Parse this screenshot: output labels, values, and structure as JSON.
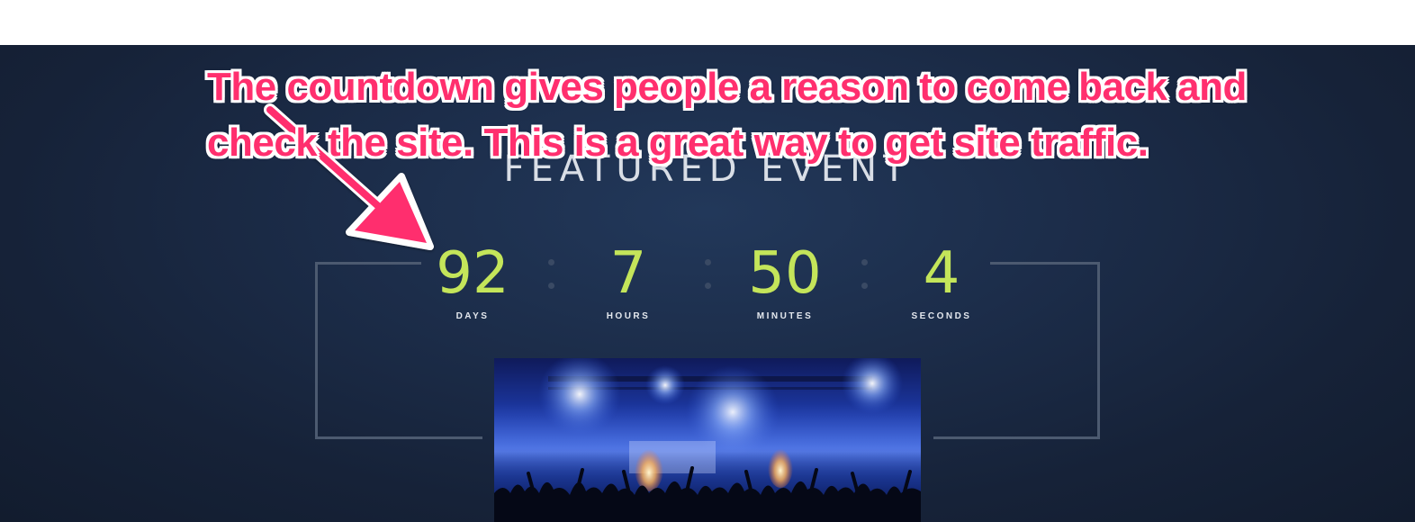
{
  "featured": {
    "title": "FEATURED EVENT"
  },
  "countdown": {
    "units": [
      {
        "value": "92",
        "label": "DAYS"
      },
      {
        "value": "7",
        "label": "HOURS"
      },
      {
        "value": "50",
        "label": "MINUTES"
      },
      {
        "value": "4",
        "label": "SECONDS"
      }
    ],
    "accent_color": "#c4e55a"
  },
  "annotation": {
    "line1": "The countdown gives people a reason to come back and",
    "line2": "check the site. This is a great way to get site traffic.",
    "color": "#ff2f6e"
  },
  "event_image": {
    "icon": "concert-crowd-image"
  }
}
